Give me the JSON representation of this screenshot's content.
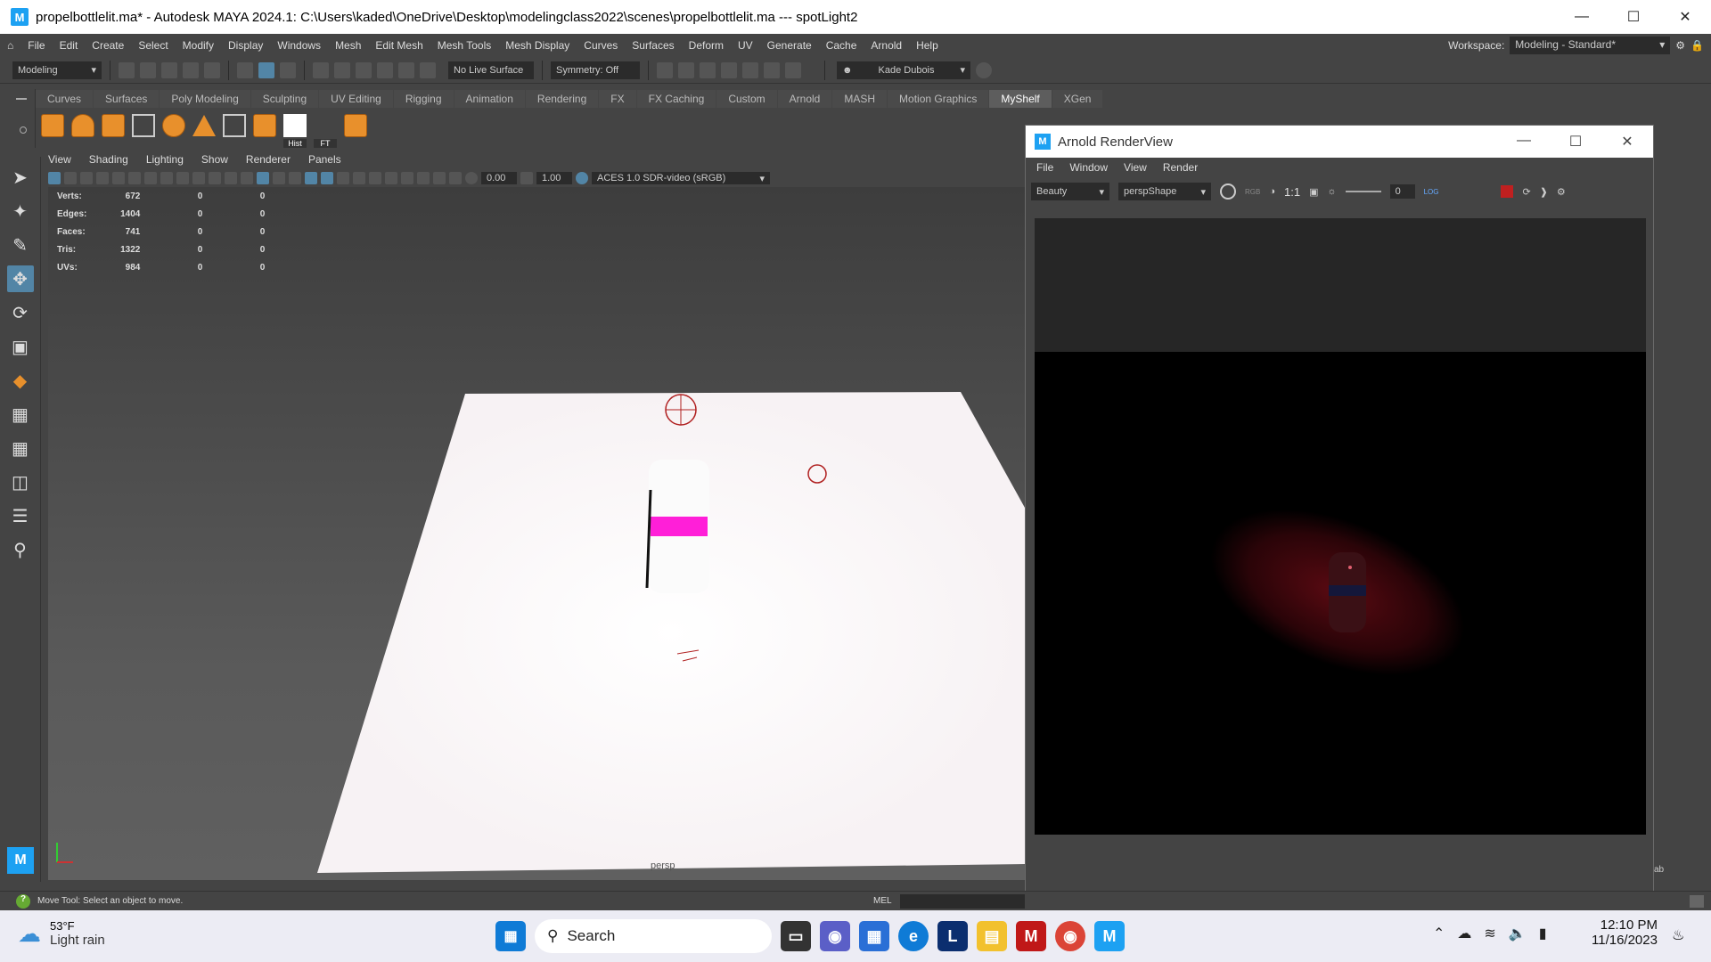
{
  "window": {
    "title": "propelbottlelit.ma* - Autodesk MAYA 2024.1: C:\\Users\\kaded\\OneDrive\\Desktop\\modelingclass2022\\scenes\\propelbottlelit.ma    ---    spotLight2",
    "logo": "M"
  },
  "menubar": {
    "items": [
      "File",
      "Edit",
      "Create",
      "Select",
      "Modify",
      "Display",
      "Windows",
      "Mesh",
      "Edit Mesh",
      "Mesh Tools",
      "Mesh Display",
      "Curves",
      "Surfaces",
      "Deform",
      "UV",
      "Generate",
      "Cache",
      "Arnold",
      "Help"
    ],
    "workspace_label": "Workspace:",
    "workspace_value": "Modeling - Standard*"
  },
  "statusline": {
    "mode": "Modeling",
    "live_surface": "No Live Surface",
    "symmetry": "Symmetry: Off",
    "user": "Kade Dubois"
  },
  "shelf": {
    "tabs": [
      "Curves",
      "Surfaces",
      "Poly Modeling",
      "Sculpting",
      "UV Editing",
      "Rigging",
      "Animation",
      "Rendering",
      "FX",
      "FX Caching",
      "Custom",
      "Arnold",
      "MASH",
      "Motion Graphics",
      "MyShelf",
      "XGen"
    ],
    "active_tab": "MyShelf",
    "hist_label": "Hist",
    "ft_label": "FT"
  },
  "viewport": {
    "menu": [
      "View",
      "Shading",
      "Lighting",
      "Show",
      "Renderer",
      "Panels"
    ],
    "field1": "0.00",
    "field2": "1.00",
    "colorspace": "ACES 1.0 SDR-video (sRGB)",
    "camera_label": "persp",
    "hud": [
      {
        "label": "Verts:",
        "a": "672",
        "b": "0",
        "c": "0"
      },
      {
        "label": "Edges:",
        "a": "1404",
        "b": "0",
        "c": "0"
      },
      {
        "label": "Faces:",
        "a": "741",
        "b": "0",
        "c": "0"
      },
      {
        "label": "Tris:",
        "a": "1322",
        "b": "0",
        "c": "0"
      },
      {
        "label": "UVs:",
        "a": "984",
        "b": "0",
        "c": "0"
      }
    ]
  },
  "renderview": {
    "title": "Arnold RenderView",
    "menu": [
      "File",
      "Window",
      "View",
      "Render"
    ],
    "aov": "Beauty",
    "camera": "perspShape",
    "ratio": "1:1",
    "exposure": "0",
    "log": "LOG"
  },
  "cmdline": {
    "help": "Move Tool: Select an object to move.",
    "lang": "MEL",
    "side_text": "ab"
  },
  "taskbar": {
    "temp": "53°F",
    "weather": "Light rain",
    "search": "Search",
    "time": "12:10 PM",
    "date": "11/16/2023",
    "colors": {
      "edge": "#0f7bd6",
      "maya": "#1da1f2",
      "mcafee": "#c01818",
      "chrome_red": "#db4437"
    }
  },
  "colors": {
    "accent": "#5285a6",
    "shelf_icon": "#e8902c",
    "bottle_label": "#ff1fd8"
  }
}
